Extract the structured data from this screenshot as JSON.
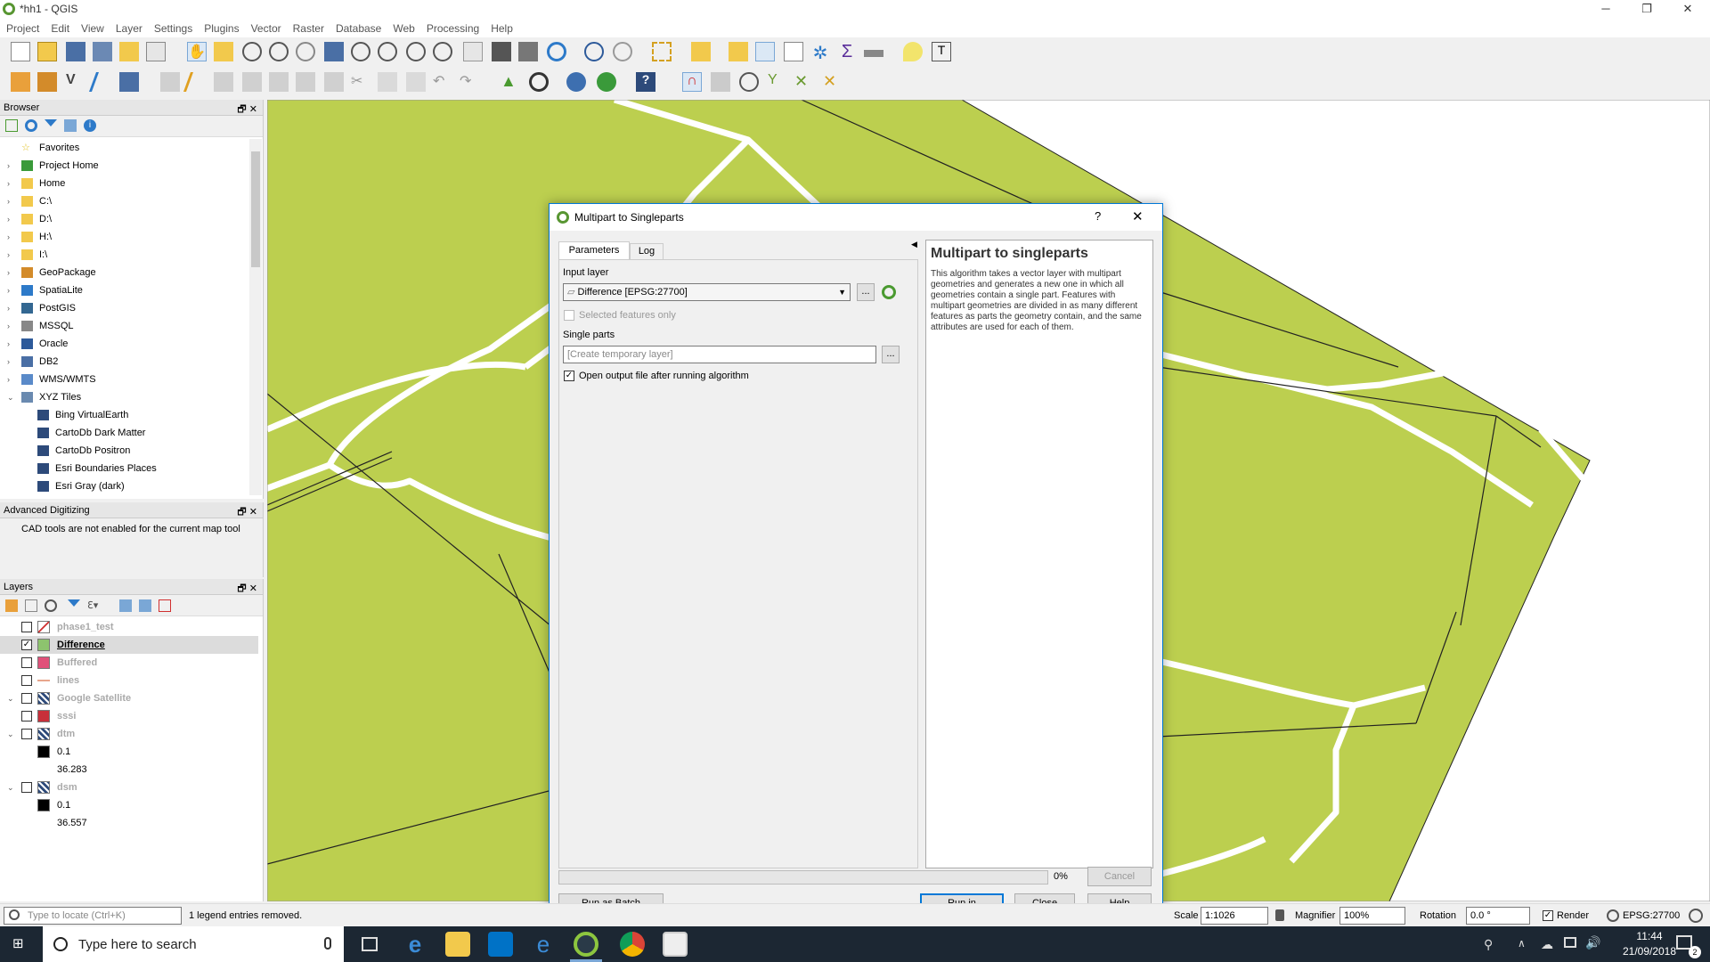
{
  "window": {
    "title": "*hh1 - QGIS",
    "min": "─",
    "max": "❐",
    "close": "✕"
  },
  "menu": [
    "Project",
    "Edit",
    "View",
    "Layer",
    "Settings",
    "Plugins",
    "Vector",
    "Raster",
    "Database",
    "Web",
    "Processing",
    "Help"
  ],
  "browser": {
    "title": "Browser",
    "items": [
      {
        "label": "Favorites",
        "icon": "star-icon"
      },
      {
        "label": "Project Home",
        "icon": "project-home-icon"
      },
      {
        "label": "Home",
        "icon": "folder-icon"
      },
      {
        "label": "C:\\",
        "icon": "folder-icon"
      },
      {
        "label": "D:\\",
        "icon": "folder-icon"
      },
      {
        "label": "H:\\",
        "icon": "folder-icon"
      },
      {
        "label": "I:\\",
        "icon": "folder-icon"
      },
      {
        "label": "GeoPackage",
        "icon": "geopackage-icon"
      },
      {
        "label": "SpatiaLite",
        "icon": "spatialite-icon"
      },
      {
        "label": "PostGIS",
        "icon": "postgis-icon"
      },
      {
        "label": "MSSQL",
        "icon": "mssql-icon"
      },
      {
        "label": "Oracle",
        "icon": "oracle-icon"
      },
      {
        "label": "DB2",
        "icon": "db2-icon"
      },
      {
        "label": "WMS/WMTS",
        "icon": "wms-icon"
      },
      {
        "label": "XYZ Tiles",
        "icon": "xyz-icon"
      },
      {
        "label": "Bing VirtualEarth",
        "icon": "tile-icon"
      },
      {
        "label": "CartoDb Dark Matter",
        "icon": "tile-icon"
      },
      {
        "label": "CartoDb Positron",
        "icon": "tile-icon"
      },
      {
        "label": "Esri Boundaries Places",
        "icon": "tile-icon"
      },
      {
        "label": "Esri Gray (dark)",
        "icon": "tile-icon"
      }
    ]
  },
  "advanced": {
    "title": "Advanced Digitizing",
    "message": "CAD tools are not enabled for the current map tool"
  },
  "layers": {
    "title": "Layers",
    "items": [
      {
        "label": "phase1_test",
        "checked": false,
        "color": "#ffffff"
      },
      {
        "label": "Difference",
        "checked": true,
        "color": "#8dc36e"
      },
      {
        "label": "Buffered",
        "checked": false,
        "color": "#e0517a"
      },
      {
        "label": "lines",
        "checked": false,
        "color": "#e8a68c"
      },
      {
        "label": "Google Satellite",
        "checked": false,
        "color": "#000000"
      },
      {
        "label": "sssi",
        "checked": false,
        "color": "#c8303a"
      },
      {
        "label": "dtm",
        "checked": false,
        "color": "#000000"
      },
      {
        "label": "0.1",
        "checked": false,
        "color": "#000000"
      },
      {
        "label": "36.283",
        "checked": false,
        "color": ""
      },
      {
        "label": "dsm",
        "checked": false,
        "color": "#000000"
      },
      {
        "label": "0.1",
        "checked": false,
        "color": "#000000"
      },
      {
        "label": "36.557",
        "checked": false,
        "color": ""
      }
    ]
  },
  "dialog": {
    "title": "Multipart to Singleparts",
    "help_btn": "?",
    "close_btn": "✕",
    "tabs": [
      "Parameters",
      "Log"
    ],
    "input_layer_label": "Input layer",
    "input_layer_value": "Difference [EPSG:27700]",
    "selected_only": "Selected features only",
    "single_parts_label": "Single parts",
    "single_parts_placeholder": "[Create temporary layer]",
    "open_output": "Open output file after running algorithm",
    "progress": "0%",
    "cancel": "Cancel",
    "batch": "Run as Batch Process...",
    "run_bg": "Run in Background",
    "close": "Close",
    "help": "Help",
    "help_title": "Multipart to singleparts",
    "help_text": "This algorithm takes a vector layer with multipart geometries and generates a new one in which all geometries contain a single part. Features with multipart geometries are divided in as many different features as parts the geometry contain, and the same attributes are used for each of them.",
    "ellipsis": "..."
  },
  "status": {
    "locate_placeholder": "Type to locate (Ctrl+K)",
    "message": "1 legend entries removed.",
    "scale_label": "Scale",
    "scale_value": "1:1026",
    "magnifier_label": "Magnifier",
    "magnifier_value": "100%",
    "rotation_label": "Rotation",
    "rotation_value": "0.0 °",
    "render_label": "Render",
    "crs": "EPSG:27700"
  },
  "taskbar": {
    "search_placeholder": "Type here to search",
    "time": "11:44",
    "date": "21/09/2018",
    "notif": "2"
  },
  "colors": {
    "map_fill": "#bccf4f",
    "accent": "#0078d7"
  }
}
